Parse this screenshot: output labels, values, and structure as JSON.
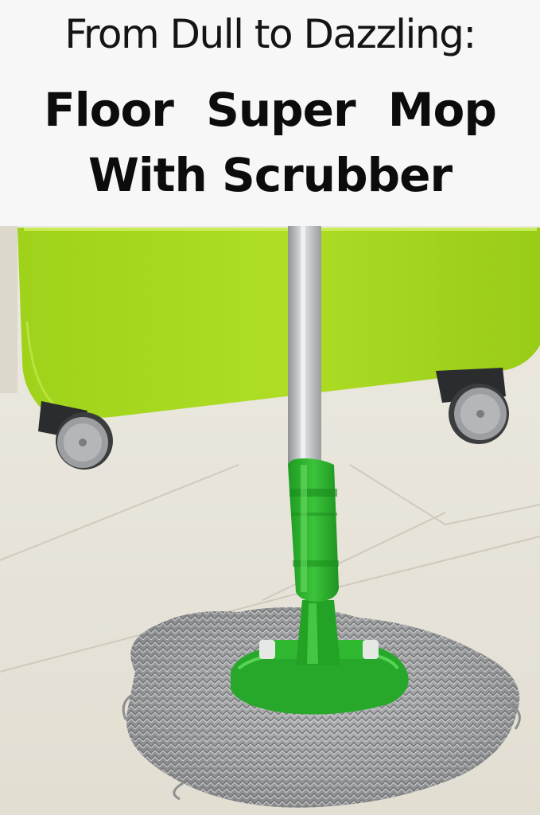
{
  "header": {
    "subtitle": "From Dull to Dazzling:",
    "title_line1": "Floor   Super  Mop",
    "title_line2": "With Scrubber"
  },
  "photo": {
    "subject": "green spin mop with grey microfiber head in front of lime-green wheeled bucket",
    "colors": {
      "bucket": "#a6d81e",
      "mop_base": "#2fb830",
      "floor": "#e6e2d6",
      "handle": "#b9bcbe",
      "mop_strands": "#9a9c9e"
    }
  }
}
